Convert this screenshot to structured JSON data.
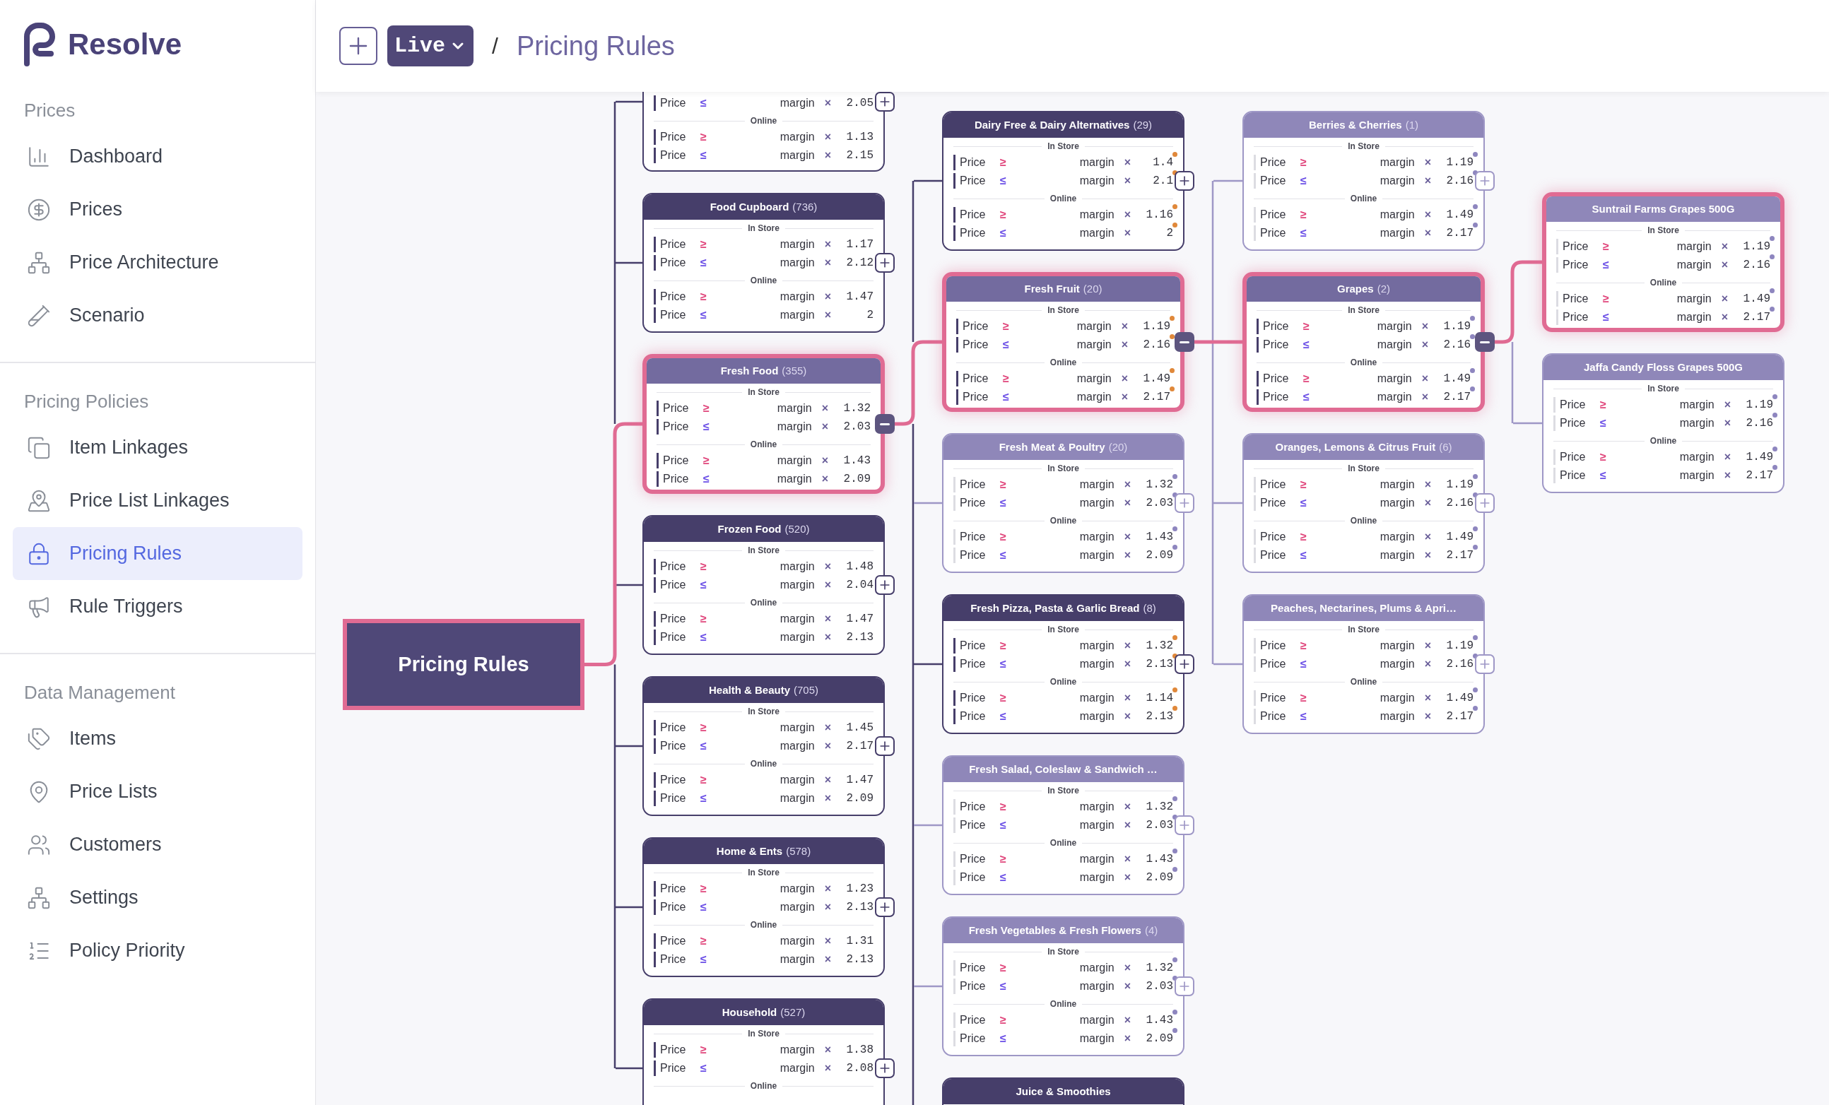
{
  "app": {
    "name": "Resolve"
  },
  "header": {
    "live_label": "Live",
    "separator": "/",
    "breadcrumb": "Pricing Rules"
  },
  "sidebar": {
    "sections": [
      {
        "title": "Prices",
        "items": [
          {
            "label": "Dashboard",
            "selected": false
          },
          {
            "label": "Prices",
            "selected": false
          },
          {
            "label": "Price Architecture",
            "selected": false
          },
          {
            "label": "Scenario",
            "selected": false
          }
        ]
      },
      {
        "title": "Pricing Policies",
        "items": [
          {
            "label": "Item Linkages",
            "selected": false
          },
          {
            "label": "Price List Linkages",
            "selected": false
          },
          {
            "label": "Pricing Rules",
            "selected": true
          },
          {
            "label": "Rule Triggers",
            "selected": false
          }
        ]
      },
      {
        "title": "Data Management",
        "items": [
          {
            "label": "Items",
            "selected": false
          },
          {
            "label": "Price Lists",
            "selected": false
          },
          {
            "label": "Customers",
            "selected": false
          },
          {
            "label": "Settings",
            "selected": false
          },
          {
            "label": "Policy Priority",
            "selected": false
          }
        ]
      }
    ]
  },
  "tree": {
    "root": {
      "label": "Pricing Rules",
      "selected": true
    },
    "columns": [
      [
        {
          "kind": "dark",
          "selected": false,
          "expanded": false,
          "sections": [
            {
              "rules": [
                {
                  "field": "Price",
                  "op": "≤",
                  "kind": "max",
                  "factor": "margin",
                  "times": "×",
                  "value": "2.05"
                }
              ]
            },
            {
              "label": "Online",
              "rules": [
                {
                  "field": "Price",
                  "op": "≥",
                  "kind": "min",
                  "factor": "margin",
                  "times": "×",
                  "value": "1.13"
                },
                {
                  "field": "Price",
                  "op": "≤",
                  "kind": "max",
                  "factor": "margin",
                  "times": "×",
                  "value": "2.15"
                }
              ]
            }
          ]
        },
        {
          "title": "Food Cupboard",
          "count": "(736)",
          "kind": "dark",
          "selected": false,
          "expanded": false,
          "sections": [
            {
              "label": "In Store",
              "rules": [
                {
                  "field": "Price",
                  "op": "≥",
                  "kind": "min",
                  "factor": "margin",
                  "times": "×",
                  "value": "1.17"
                },
                {
                  "field": "Price",
                  "op": "≤",
                  "kind": "max",
                  "factor": "margin",
                  "times": "×",
                  "value": "2.12"
                }
              ]
            },
            {
              "label": "Online",
              "rules": [
                {
                  "field": "Price",
                  "op": "≥",
                  "kind": "min",
                  "factor": "margin",
                  "times": "×",
                  "value": "1.47"
                },
                {
                  "field": "Price",
                  "op": "≤",
                  "kind": "max",
                  "factor": "margin",
                  "times": "×",
                  "value": "2"
                }
              ]
            }
          ]
        },
        {
          "title": "Fresh Food",
          "count": "(355)",
          "kind": "medium",
          "selected": true,
          "expanded": true,
          "sections": [
            {
              "label": "In Store",
              "rules": [
                {
                  "field": "Price",
                  "op": "≥",
                  "kind": "min",
                  "factor": "margin",
                  "times": "×",
                  "value": "1.32"
                },
                {
                  "field": "Price",
                  "op": "≤",
                  "kind": "max",
                  "factor": "margin",
                  "times": "×",
                  "value": "2.03"
                }
              ]
            },
            {
              "label": "Online",
              "rules": [
                {
                  "field": "Price",
                  "op": "≥",
                  "kind": "min",
                  "factor": "margin",
                  "times": "×",
                  "value": "1.43"
                },
                {
                  "field": "Price",
                  "op": "≤",
                  "kind": "max",
                  "factor": "margin",
                  "times": "×",
                  "value": "2.09"
                }
              ]
            }
          ]
        },
        {
          "title": "Frozen Food",
          "count": "(520)",
          "kind": "dark",
          "selected": false,
          "expanded": false,
          "sections": [
            {
              "label": "In Store",
              "rules": [
                {
                  "field": "Price",
                  "op": "≥",
                  "kind": "min",
                  "factor": "margin",
                  "times": "×",
                  "value": "1.48"
                },
                {
                  "field": "Price",
                  "op": "≤",
                  "kind": "max",
                  "factor": "margin",
                  "times": "×",
                  "value": "2.04"
                }
              ]
            },
            {
              "label": "Online",
              "rules": [
                {
                  "field": "Price",
                  "op": "≥",
                  "kind": "min",
                  "factor": "margin",
                  "times": "×",
                  "value": "1.47"
                },
                {
                  "field": "Price",
                  "op": "≤",
                  "kind": "max",
                  "factor": "margin",
                  "times": "×",
                  "value": "2.13"
                }
              ]
            }
          ]
        },
        {
          "title": "Health & Beauty",
          "count": "(705)",
          "kind": "dark",
          "selected": false,
          "expanded": false,
          "sections": [
            {
              "label": "In Store",
              "rules": [
                {
                  "field": "Price",
                  "op": "≥",
                  "kind": "min",
                  "factor": "margin",
                  "times": "×",
                  "value": "1.45"
                },
                {
                  "field": "Price",
                  "op": "≤",
                  "kind": "max",
                  "factor": "margin",
                  "times": "×",
                  "value": "2.17"
                }
              ]
            },
            {
              "label": "Online",
              "rules": [
                {
                  "field": "Price",
                  "op": "≥",
                  "kind": "min",
                  "factor": "margin",
                  "times": "×",
                  "value": "1.47"
                },
                {
                  "field": "Price",
                  "op": "≤",
                  "kind": "max",
                  "factor": "margin",
                  "times": "×",
                  "value": "2.09"
                }
              ]
            }
          ]
        },
        {
          "title": "Home & Ents",
          "count": "(578)",
          "kind": "dark",
          "selected": false,
          "expanded": false,
          "sections": [
            {
              "label": "In Store",
              "rules": [
                {
                  "field": "Price",
                  "op": "≥",
                  "kind": "min",
                  "factor": "margin",
                  "times": "×",
                  "value": "1.23"
                },
                {
                  "field": "Price",
                  "op": "≤",
                  "kind": "max",
                  "factor": "margin",
                  "times": "×",
                  "value": "2.13"
                }
              ]
            },
            {
              "label": "Online",
              "rules": [
                {
                  "field": "Price",
                  "op": "≥",
                  "kind": "min",
                  "factor": "margin",
                  "times": "×",
                  "value": "1.31"
                },
                {
                  "field": "Price",
                  "op": "≤",
                  "kind": "max",
                  "factor": "margin",
                  "times": "×",
                  "value": "2.13"
                }
              ]
            }
          ]
        },
        {
          "title": "Household",
          "count": "(527)",
          "kind": "dark",
          "selected": false,
          "expanded": false,
          "sections": [
            {
              "label": "In Store",
              "rules": [
                {
                  "field": "Price",
                  "op": "≥",
                  "kind": "min",
                  "factor": "margin",
                  "times": "×",
                  "value": "1.38"
                },
                {
                  "field": "Price",
                  "op": "≤",
                  "kind": "max",
                  "factor": "margin",
                  "times": "×",
                  "value": "2.08"
                }
              ]
            },
            {
              "label": "Online"
            }
          ]
        }
      ],
      [
        {
          "title": "Dairy Free & Dairy Alternatives",
          "count": "(29)",
          "kind": "dark",
          "selected": false,
          "expanded": false,
          "color": "#e0883a",
          "sections": [
            {
              "label": "In Store",
              "rules": [
                {
                  "field": "Price",
                  "op": "≥",
                  "kind": "min",
                  "factor": "margin",
                  "times": "×",
                  "value": "1.4"
                },
                {
                  "field": "Price",
                  "op": "≤",
                  "kind": "max",
                  "factor": "margin",
                  "times": "×",
                  "value": "2.1"
                }
              ]
            },
            {
              "label": "Online",
              "rules": [
                {
                  "field": "Price",
                  "op": "≥",
                  "kind": "min",
                  "factor": "margin",
                  "times": "×",
                  "value": "1.16"
                },
                {
                  "field": "Price",
                  "op": "≤",
                  "kind": "max",
                  "factor": "margin",
                  "times": "×",
                  "value": "2"
                }
              ]
            }
          ]
        },
        {
          "title": "Fresh Fruit",
          "count": "(20)",
          "kind": "medium",
          "selected": true,
          "expanded": true,
          "color": "#e0883a",
          "sections": [
            {
              "label": "In Store",
              "rules": [
                {
                  "field": "Price",
                  "op": "≥",
                  "kind": "min",
                  "factor": "margin",
                  "times": "×",
                  "value": "1.19"
                },
                {
                  "field": "Price",
                  "op": "≤",
                  "kind": "max",
                  "factor": "margin",
                  "times": "×",
                  "value": "2.16"
                }
              ]
            },
            {
              "label": "Online",
              "rules": [
                {
                  "field": "Price",
                  "op": "≥",
                  "kind": "min",
                  "factor": "margin",
                  "times": "×",
                  "value": "1.49"
                },
                {
                  "field": "Price",
                  "op": "≤",
                  "kind": "max",
                  "factor": "margin",
                  "times": "×",
                  "value": "2.17"
                }
              ]
            }
          ]
        },
        {
          "title": "Fresh Meat & Poultry",
          "count": "(20)",
          "kind": "light",
          "selected": false,
          "expanded": false,
          "color": "#8e86bf",
          "sections": [
            {
              "label": "In Store",
              "rules": [
                {
                  "field": "Price",
                  "op": "≥",
                  "kind": "min",
                  "factor": "margin",
                  "times": "×",
                  "value": "1.32"
                },
                {
                  "field": "Price",
                  "op": "≤",
                  "kind": "max",
                  "factor": "margin",
                  "times": "×",
                  "value": "2.03"
                }
              ]
            },
            {
              "label": "Online",
              "rules": [
                {
                  "field": "Price",
                  "op": "≥",
                  "kind": "min",
                  "factor": "margin",
                  "times": "×",
                  "value": "1.43"
                },
                {
                  "field": "Price",
                  "op": "≤",
                  "kind": "max",
                  "factor": "margin",
                  "times": "×",
                  "value": "2.09"
                }
              ]
            }
          ]
        },
        {
          "title": "Fresh Pizza, Pasta & Garlic Bread",
          "count": "(8)",
          "kind": "dark",
          "selected": false,
          "expanded": false,
          "color": "#e0883a",
          "sections": [
            {
              "label": "In Store",
              "rules": [
                {
                  "field": "Price",
                  "op": "≥",
                  "kind": "min",
                  "factor": "margin",
                  "times": "×",
                  "value": "1.32"
                },
                {
                  "field": "Price",
                  "op": "≤",
                  "kind": "max",
                  "factor": "margin",
                  "times": "×",
                  "value": "2.13"
                }
              ]
            },
            {
              "label": "Online",
              "rules": [
                {
                  "field": "Price",
                  "op": "≥",
                  "kind": "min",
                  "factor": "margin",
                  "times": "×",
                  "value": "1.14"
                },
                {
                  "field": "Price",
                  "op": "≤",
                  "kind": "max",
                  "factor": "margin",
                  "times": "×",
                  "value": "2.13"
                }
              ]
            }
          ]
        },
        {
          "title": "Fresh Salad, Coleslaw & Sandwich …",
          "kind": "light",
          "selected": false,
          "expanded": false,
          "color": "#8e86bf",
          "sections": [
            {
              "label": "In Store",
              "rules": [
                {
                  "field": "Price",
                  "op": "≥",
                  "kind": "min",
                  "factor": "margin",
                  "times": "×",
                  "value": "1.32"
                },
                {
                  "field": "Price",
                  "op": "≤",
                  "kind": "max",
                  "factor": "margin",
                  "times": "×",
                  "value": "2.03"
                }
              ]
            },
            {
              "label": "Online",
              "rules": [
                {
                  "field": "Price",
                  "op": "≥",
                  "kind": "min",
                  "factor": "margin",
                  "times": "×",
                  "value": "1.43"
                },
                {
                  "field": "Price",
                  "op": "≤",
                  "kind": "max",
                  "factor": "margin",
                  "times": "×",
                  "value": "2.09"
                }
              ]
            }
          ]
        },
        {
          "title": "Fresh Vegetables & Fresh Flowers",
          "count": "(4)",
          "kind": "light",
          "selected": false,
          "expanded": false,
          "color": "#8e86bf",
          "sections": [
            {
              "label": "In Store",
              "rules": [
                {
                  "field": "Price",
                  "op": "≥",
                  "kind": "min",
                  "factor": "margin",
                  "times": "×",
                  "value": "1.32"
                },
                {
                  "field": "Price",
                  "op": "≤",
                  "kind": "max",
                  "factor": "margin",
                  "times": "×",
                  "value": "2.03"
                }
              ]
            },
            {
              "label": "Online",
              "rules": [
                {
                  "field": "Price",
                  "op": "≥",
                  "kind": "min",
                  "factor": "margin",
                  "times": "×",
                  "value": "1.43"
                },
                {
                  "field": "Price",
                  "op": "≤",
                  "kind": "max",
                  "factor": "margin",
                  "times": "×",
                  "value": "2.09"
                }
              ]
            }
          ]
        },
        {
          "title": "Juice & Smoothies",
          "kind": "dark",
          "selected": false
        }
      ],
      [
        {
          "title": "Berries & Cherries",
          "count": "(1)",
          "kind": "light",
          "selected": false,
          "expanded": false,
          "color": "#8e86bf",
          "sections": [
            {
              "label": "In Store",
              "rules": [
                {
                  "field": "Price",
                  "op": "≥",
                  "kind": "min",
                  "factor": "margin",
                  "times": "×",
                  "value": "1.19"
                },
                {
                  "field": "Price",
                  "op": "≤",
                  "kind": "max",
                  "factor": "margin",
                  "times": "×",
                  "value": "2.16"
                }
              ]
            },
            {
              "label": "Online",
              "rules": [
                {
                  "field": "Price",
                  "op": "≥",
                  "kind": "min",
                  "factor": "margin",
                  "times": "×",
                  "value": "1.49"
                },
                {
                  "field": "Price",
                  "op": "≤",
                  "kind": "max",
                  "factor": "margin",
                  "times": "×",
                  "value": "2.17"
                }
              ]
            }
          ]
        },
        {
          "title": "Grapes",
          "count": "(2)",
          "kind": "medium",
          "selected": true,
          "expanded": true,
          "color": "#8e86bf",
          "sections": [
            {
              "label": "In Store",
              "rules": [
                {
                  "field": "Price",
                  "op": "≥",
                  "kind": "min",
                  "factor": "margin",
                  "times": "×",
                  "value": "1.19"
                },
                {
                  "field": "Price",
                  "op": "≤",
                  "kind": "max",
                  "factor": "margin",
                  "times": "×",
                  "value": "2.16"
                }
              ]
            },
            {
              "label": "Online",
              "rules": [
                {
                  "field": "Price",
                  "op": "≥",
                  "kind": "min",
                  "factor": "margin",
                  "times": "×",
                  "value": "1.49"
                },
                {
                  "field": "Price",
                  "op": "≤",
                  "kind": "max",
                  "factor": "margin",
                  "times": "×",
                  "value": "2.17"
                }
              ]
            }
          ]
        },
        {
          "title": "Oranges, Lemons & Citrus Fruit",
          "count": "(6)",
          "kind": "light",
          "selected": false,
          "expanded": false,
          "color": "#8e86bf",
          "sections": [
            {
              "label": "In Store",
              "rules": [
                {
                  "field": "Price",
                  "op": "≥",
                  "kind": "min",
                  "factor": "margin",
                  "times": "×",
                  "value": "1.19"
                },
                {
                  "field": "Price",
                  "op": "≤",
                  "kind": "max",
                  "factor": "margin",
                  "times": "×",
                  "value": "2.16"
                }
              ]
            },
            {
              "label": "Online",
              "rules": [
                {
                  "field": "Price",
                  "op": "≥",
                  "kind": "min",
                  "factor": "margin",
                  "times": "×",
                  "value": "1.49"
                },
                {
                  "field": "Price",
                  "op": "≤",
                  "kind": "max",
                  "factor": "margin",
                  "times": "×",
                  "value": "2.17"
                }
              ]
            }
          ]
        },
        {
          "title": "Peaches, Nectarines, Plums & Apri…",
          "kind": "light",
          "selected": false,
          "expanded": false,
          "color": "#8e86bf",
          "sections": [
            {
              "label": "In Store",
              "rules": [
                {
                  "field": "Price",
                  "op": "≥",
                  "kind": "min",
                  "factor": "margin",
                  "times": "×",
                  "value": "1.19"
                },
                {
                  "field": "Price",
                  "op": "≤",
                  "kind": "max",
                  "factor": "margin",
                  "times": "×",
                  "value": "2.16"
                }
              ]
            },
            {
              "label": "Online",
              "rules": [
                {
                  "field": "Price",
                  "op": "≥",
                  "kind": "min",
                  "factor": "margin",
                  "times": "×",
                  "value": "1.49"
                },
                {
                  "field": "Price",
                  "op": "≤",
                  "kind": "max",
                  "factor": "margin",
                  "times": "×",
                  "value": "2.17"
                }
              ]
            }
          ]
        }
      ],
      [
        {
          "title": "Suntrail Farms Grapes 500G",
          "kind": "light",
          "selected": true,
          "color": "#8e86bf",
          "sections": [
            {
              "label": "In Store",
              "rules": [
                {
                  "field": "Price",
                  "op": "≥",
                  "kind": "min",
                  "factor": "margin",
                  "times": "×",
                  "value": "1.19"
                },
                {
                  "field": "Price",
                  "op": "≤",
                  "kind": "max",
                  "factor": "margin",
                  "times": "×",
                  "value": "2.16"
                }
              ]
            },
            {
              "label": "Online",
              "rules": [
                {
                  "field": "Price",
                  "op": "≥",
                  "kind": "min",
                  "factor": "margin",
                  "times": "×",
                  "value": "1.49"
                },
                {
                  "field": "Price",
                  "op": "≤",
                  "kind": "max",
                  "factor": "margin",
                  "times": "×",
                  "value": "2.17"
                }
              ]
            }
          ]
        },
        {
          "title": "Jaffa Candy Floss Grapes 500G",
          "kind": "light",
          "selected": false,
          "color": "#8e86bf",
          "sections": [
            {
              "label": "In Store",
              "rules": [
                {
                  "field": "Price",
                  "op": "≥",
                  "kind": "min",
                  "factor": "margin",
                  "times": "×",
                  "value": "1.19"
                },
                {
                  "field": "Price",
                  "op": "≤",
                  "kind": "max",
                  "factor": "margin",
                  "times": "×",
                  "value": "2.16"
                }
              ]
            },
            {
              "label": "Online",
              "rules": [
                {
                  "field": "Price",
                  "op": "≥",
                  "kind": "min",
                  "factor": "margin",
                  "times": "×",
                  "value": "1.49"
                },
                {
                  "field": "Price",
                  "op": "≤",
                  "kind": "max",
                  "factor": "margin",
                  "times": "×",
                  "value": "2.17"
                }
              ]
            }
          ]
        }
      ]
    ]
  }
}
